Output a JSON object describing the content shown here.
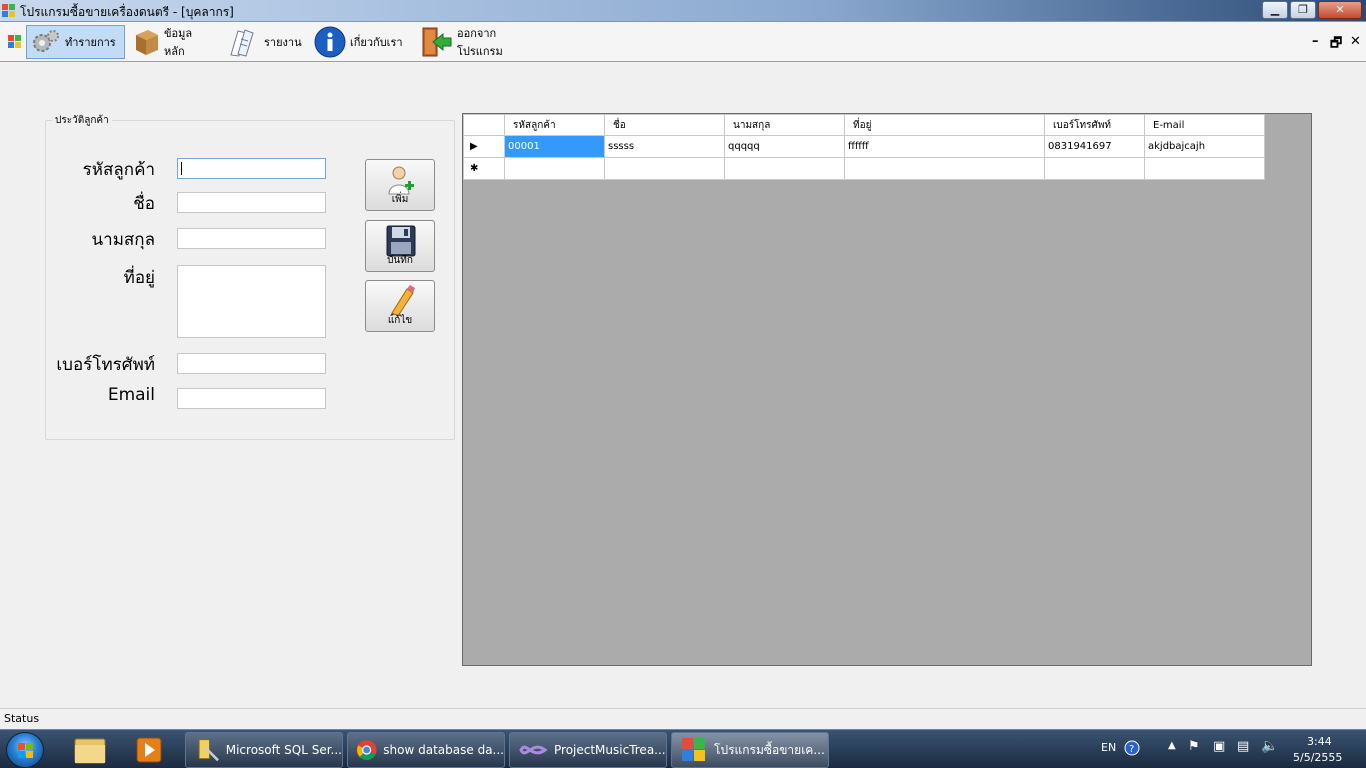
{
  "window": {
    "title": "โปรแกรมซื้อขายเครื่องดนตรี - [บุคลากร]",
    "min_icon": "minimize-icon",
    "max_icon": "maximize-icon",
    "close_icon": "close-icon"
  },
  "menu": {
    "items": [
      {
        "label": "ทำรายการ",
        "icon": "gears-icon"
      },
      {
        "label": "ข้อมูลหลัก",
        "icon": "box-icon"
      },
      {
        "label": "รายงาน",
        "icon": "papers-icon"
      },
      {
        "label": "เกี่ยวกับเรา",
        "icon": "info-icon"
      },
      {
        "label": "ออกจากโปรแกรม",
        "icon": "exit-door-icon"
      }
    ],
    "mdi_controls": {
      "minimize": "–",
      "restore": "🗗",
      "close": "✕"
    }
  },
  "form": {
    "group_title": "ประวัติลูกค้า",
    "labels": {
      "customer_id": "รหัสลูกค้า",
      "first_name": "ชื่อ",
      "last_name": "นามสกุล",
      "address": "ที่อยู่",
      "phone": "เบอร์โทรศัพท์",
      "email": "Email"
    },
    "values": {
      "customer_id": "",
      "first_name": "",
      "last_name": "",
      "address": "",
      "phone": "",
      "email": ""
    },
    "buttons": {
      "add": "เพิ่ม",
      "save": "บันทึก",
      "edit": "แก้ไข"
    }
  },
  "grid": {
    "columns": [
      "รหัสลูกค้า",
      "ชื่อ",
      "นามสกุล",
      "ที่อยู่",
      "เบอร์โทรศัพท์",
      "E-mail"
    ],
    "rows": [
      {
        "marker": "▶",
        "cells": [
          "00001",
          "sssss",
          "qqqqq",
          "ffffff",
          "0831941697",
          "akjdbajcajh"
        ]
      },
      {
        "marker": "✱",
        "cells": [
          "",
          "",
          "",
          "",
          "",
          ""
        ]
      }
    ]
  },
  "status": {
    "text": "Status"
  },
  "taskbar": {
    "tasks": [
      {
        "label": "Microsoft SQL Ser..."
      },
      {
        "label": "show database da..."
      },
      {
        "label": "ProjectMusicTrea..."
      },
      {
        "label": "โปรแกรมซื้อขายเค..."
      }
    ],
    "tray": {
      "lang": "EN",
      "time": "3:44",
      "date": "5/5/2555"
    },
    "colors": {
      "accent": "#3399ff"
    }
  }
}
